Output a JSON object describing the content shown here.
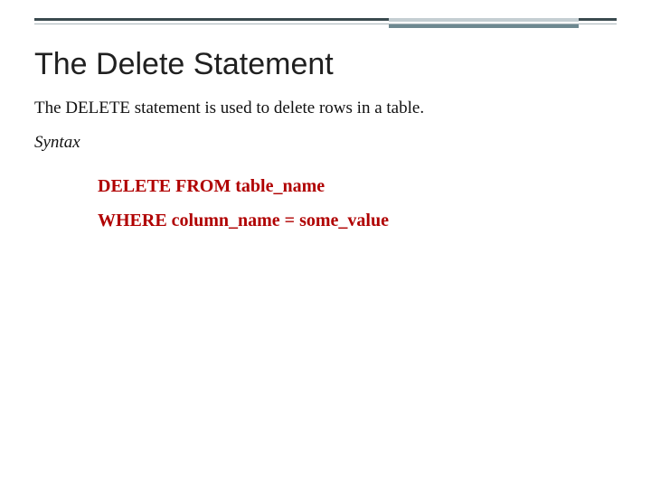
{
  "title": "The Delete Statement",
  "description": "The DELETE statement is used to delete rows in a table.",
  "syntax_label": "Syntax",
  "code": {
    "line1": "DELETE FROM table_name",
    "line2": "WHERE column_name = some_value"
  },
  "colors": {
    "code": "#b00000",
    "rule_dark": "#3a4a4f",
    "rule_light": "#a9b5ba",
    "highlight_top": "#c4ced2",
    "highlight_bottom": "#6d8890"
  }
}
